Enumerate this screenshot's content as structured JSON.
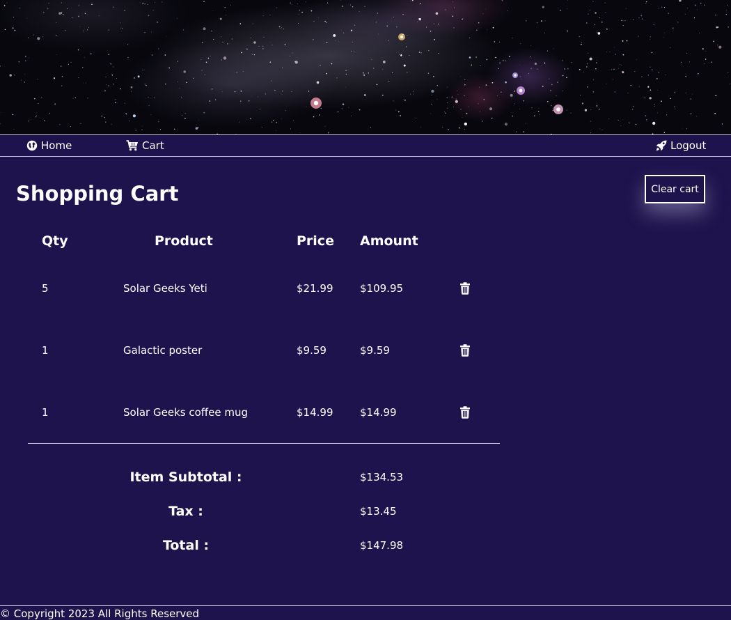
{
  "nav": {
    "home_label": "Home",
    "cart_label": "Cart",
    "logout_label": "Logout"
  },
  "page": {
    "title": "Shopping Cart",
    "clear_label": "Clear cart"
  },
  "table": {
    "headers": {
      "qty": "Qty",
      "product": "Product",
      "price": "Price",
      "amount": "Amount"
    },
    "rows": [
      {
        "qty": "5",
        "product": "Solar Geeks Yeti",
        "price": "$21.99",
        "amount": "$109.95"
      },
      {
        "qty": "1",
        "product": "Galactic poster",
        "price": "$9.59",
        "amount": "$9.59"
      },
      {
        "qty": "1",
        "product": "Solar Geeks coffee mug",
        "price": "$14.99",
        "amount": "$14.99"
      }
    ]
  },
  "summary": [
    {
      "label": "Item Subtotal :",
      "value": "$134.53"
    },
    {
      "label": "Tax :",
      "value": "$13.45"
    },
    {
      "label": "Total :",
      "value": "$147.98"
    }
  ],
  "footer": {
    "text": "© Copyright 2023 All Rights Reserved"
  },
  "icons": {
    "home": "globe-icon",
    "cart": "cart-icon",
    "logout": "rocket-icon",
    "delete": "trash-icon"
  },
  "colors": {
    "background": "#1e134d",
    "text": "#ffffff"
  }
}
